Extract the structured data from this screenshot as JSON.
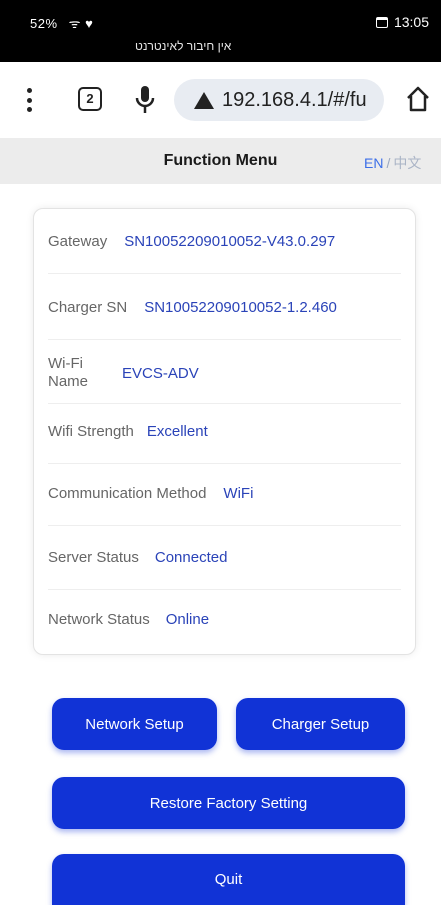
{
  "statusbar": {
    "left": "52%  ᯤ ♥",
    "center": "אין חיבור לאינטרנט",
    "time": "13:05"
  },
  "browser": {
    "tab_count": "2",
    "url": "192.168.4.1/#/fu"
  },
  "header": {
    "title": "Function Menu",
    "lang_en": "EN",
    "lang_sep": "/",
    "lang_zh": "中文"
  },
  "info": {
    "gateway_label": "Gateway",
    "gateway_value": "SN10052209010052-V43.0.297",
    "charger_sn_label": "Charger SN",
    "charger_sn_value": "SN10052209010052-1.2.460",
    "wifi_name_label_1": "Wi-Fi",
    "wifi_name_label_2": "Name",
    "wifi_name_value": "EVCS-ADV",
    "wifi_strength_label": "Wifi Strength",
    "wifi_strength_value": "Excellent",
    "comm_label": "Communication Method",
    "comm_value": "WiFi",
    "server_label": "Server Status",
    "server_value": "Connected",
    "network_label": "Network Status",
    "network_value": "Online"
  },
  "buttons": {
    "network_setup": "Network Setup",
    "charger_setup": "Charger Setup",
    "restore": "Restore Factory Setting",
    "quit": "Quit"
  },
  "colors": {
    "accent": "#1133d6",
    "value_text": "#2a43b8",
    "lang_active": "#3b6ee8"
  }
}
